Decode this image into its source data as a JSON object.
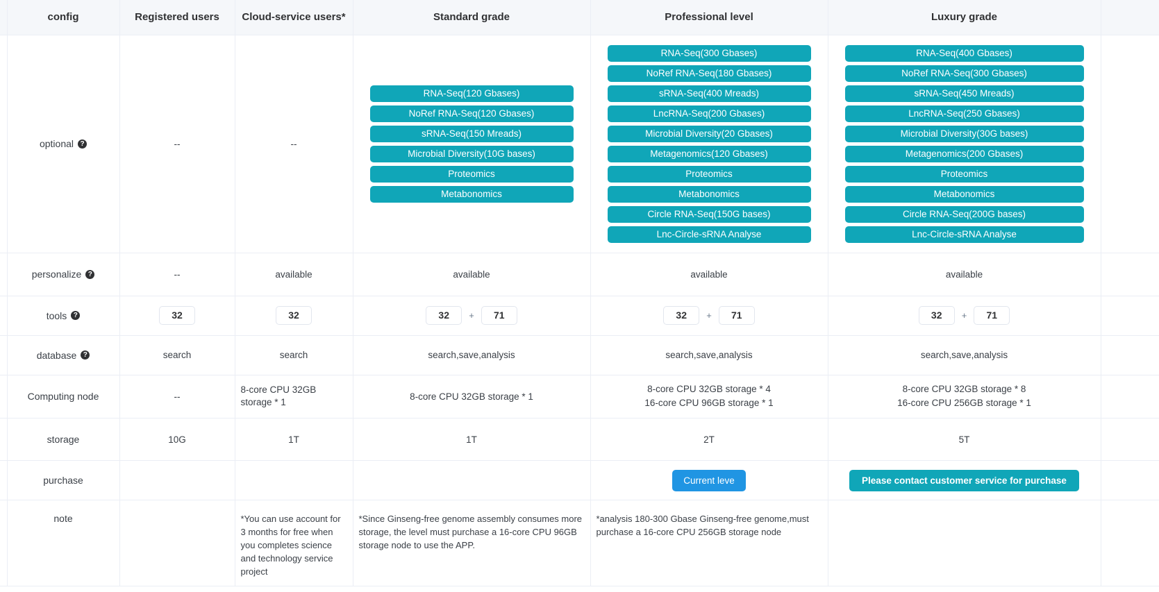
{
  "table": {
    "columns": [
      {
        "key": "config",
        "label": "config"
      },
      {
        "key": "registered",
        "label": "Registered users"
      },
      {
        "key": "cloud",
        "label": "Cloud-service users*"
      },
      {
        "key": "standard",
        "label": "Standard grade"
      },
      {
        "key": "professional",
        "label": "Professional level"
      },
      {
        "key": "luxury",
        "label": "Luxury grade"
      }
    ],
    "colors": {
      "teal_button": "#10a6b8",
      "blue_button": "#2095e3",
      "header_bg": "#f5f7fa",
      "border": "#ebeef5",
      "text": "#3b4047"
    },
    "rows": {
      "optional": {
        "label": "optional",
        "help_icon": "?",
        "registered": "--",
        "cloud": "--",
        "standard_options": [
          "RNA-Seq(120 Gbases)",
          "NoRef RNA-Seq(120 Gbases)",
          "sRNA-Seq(150 Mreads)",
          "Microbial Diversity(10G bases)",
          "Proteomics",
          "Metabonomics"
        ],
        "professional_options": [
          "RNA-Seq(300 Gbases)",
          "NoRef RNA-Seq(180 Gbases)",
          "sRNA-Seq(400 Mreads)",
          "LncRNA-Seq(200 Gbases)",
          "Microbial Diversity(20 Gbases)",
          "Metagenomics(120 Gbases)",
          "Proteomics",
          "Metabonomics",
          "Circle RNA-Seq(150G bases)",
          "Lnc-Circle-sRNA Analyse"
        ],
        "luxury_options": [
          "RNA-Seq(400 Gbases)",
          "NoRef RNA-Seq(300 Gbases)",
          "sRNA-Seq(450 Mreads)",
          "LncRNA-Seq(250 Gbases)",
          "Microbial Diversity(30G bases)",
          "Metagenomics(200 Gbases)",
          "Proteomics",
          "Metabonomics",
          "Circle RNA-Seq(200G bases)",
          "Lnc-Circle-sRNA Analyse"
        ]
      },
      "personalize": {
        "label": "personalize",
        "help_icon": "?",
        "registered": "--",
        "cloud": "available",
        "standard": "available",
        "professional": "available",
        "luxury": "available"
      },
      "tools": {
        "label": "tools",
        "help_icon": "?",
        "registered": {
          "base": "32"
        },
        "cloud": {
          "base": "32"
        },
        "standard": {
          "base": "32",
          "plus": "+",
          "extra": "71"
        },
        "professional": {
          "base": "32",
          "plus": "+",
          "extra": "71"
        },
        "luxury": {
          "base": "32",
          "plus": "+",
          "extra": "71"
        }
      },
      "database": {
        "label": "database",
        "help_icon": "?",
        "registered": "search",
        "cloud": "search",
        "standard": "search,save,analysis",
        "professional": "search,save,analysis",
        "luxury": "search,save,analysis"
      },
      "computing_node": {
        "label": "Computing node",
        "registered": "--",
        "cloud": "8-core CPU 32GB storage * 1",
        "standard": "8-core CPU 32GB storage * 1",
        "professional_line1": "8-core CPU 32GB storage * 4",
        "professional_line2": "16-core CPU 96GB storage * 1",
        "luxury_line1": "8-core CPU 32GB storage * 8",
        "luxury_line2": "16-core CPU 256GB storage * 1"
      },
      "storage": {
        "label": "storage",
        "registered": "10G",
        "cloud": "1T",
        "standard": "1T",
        "professional": "2T",
        "luxury": "5T"
      },
      "purchase": {
        "label": "purchase",
        "registered": "",
        "cloud": "",
        "standard": "",
        "professional_button": "Current leve",
        "luxury_button": "Please contact customer service for purchase"
      },
      "note": {
        "label": "note",
        "registered": "",
        "cloud": "*You can use account for 3 months for free when you completes science and technology service project",
        "standard": "*Since Ginseng-free genome assembly consumes more storage, the level must purchase a 16-core CPU 96GB storage node to use the APP.",
        "professional": "*analysis 180-300 Gbase Ginseng-free genome,must purchase a 16-core CPU 256GB storage node",
        "luxury": ""
      }
    }
  }
}
